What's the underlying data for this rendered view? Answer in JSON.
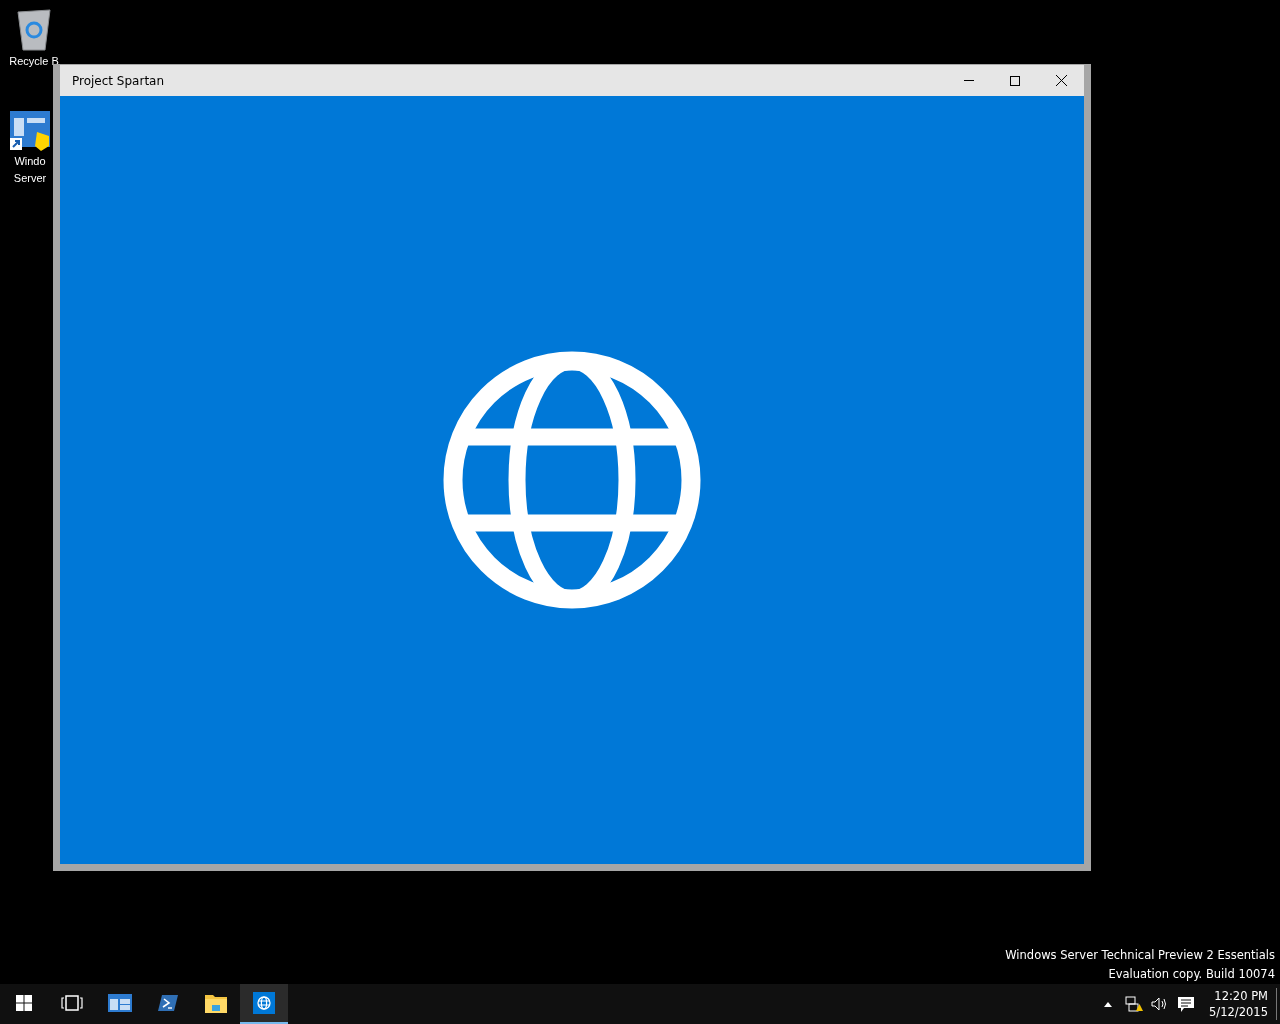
{
  "desktop": {
    "icons": [
      {
        "kind": "recycle-bin",
        "lines": [
          "Recycle B"
        ]
      },
      {
        "kind": "server",
        "lines": [
          "Windo",
          "Server"
        ]
      }
    ]
  },
  "window": {
    "title": "Project Spartan"
  },
  "desktop_notice": [
    "Windows Server Technical Preview 2 Essentials",
    "Evaluation copy. Build 10074"
  ],
  "taskbar": {
    "apps": [
      {
        "kind": "start",
        "selected": false
      },
      {
        "kind": "task-view",
        "selected": false
      },
      {
        "kind": "server",
        "selected": false
      },
      {
        "kind": "powershell",
        "selected": false
      },
      {
        "kind": "explorer",
        "selected": false
      },
      {
        "kind": "browser",
        "selected": true
      }
    ],
    "tray": [
      {
        "kind": "caret"
      },
      {
        "kind": "network"
      },
      {
        "kind": "volume"
      },
      {
        "kind": "notifications"
      }
    ],
    "time": "12:20 PM",
    "date": "5/12/2015"
  }
}
